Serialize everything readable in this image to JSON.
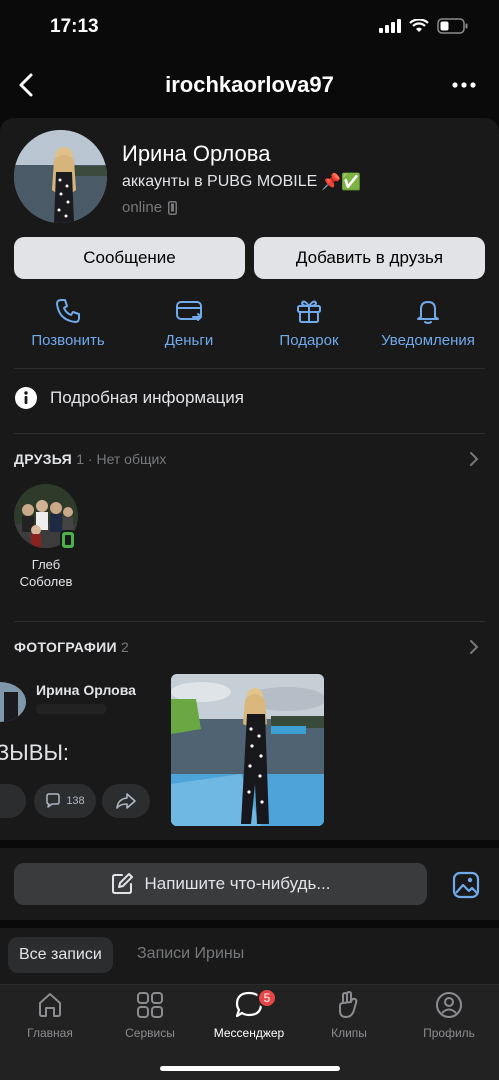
{
  "status_bar": {
    "time": "17:13"
  },
  "header": {
    "title": "irochkaorlova97"
  },
  "profile": {
    "name": "Ирина Орлова",
    "status": "аккаунты в PUBG MOBILE",
    "status_emojis": "📌✅",
    "online": "online"
  },
  "buttons": {
    "message": "Сообщение",
    "add_friend": "Добавить в друзья"
  },
  "actions": [
    {
      "label": "Позвонить",
      "icon": "phone-icon"
    },
    {
      "label": "Деньги",
      "icon": "money-icon"
    },
    {
      "label": "Подарок",
      "icon": "gift-icon"
    },
    {
      "label": "Уведомления",
      "icon": "bell-icon"
    }
  ],
  "details": {
    "label": "Подробная информация"
  },
  "friends": {
    "title": "ДРУЗЬЯ",
    "count": "1",
    "common": "Нет общих",
    "items": [
      {
        "name": "Глеб Соболев"
      }
    ]
  },
  "photos": {
    "title": "ФОТОГРАФИИ",
    "count": "2",
    "post_preview": {
      "author": "Ирина Орлова",
      "text": "ЗЫВЫ:",
      "comments": "138"
    }
  },
  "composer": {
    "placeholder": "Напишите что-нибудь..."
  },
  "wall_tabs": {
    "all": "Все записи",
    "own": "Записи Ирины"
  },
  "tabbar": {
    "items": [
      {
        "label": "Главная",
        "icon": "home-icon"
      },
      {
        "label": "Сервисы",
        "icon": "services-icon"
      },
      {
        "label": "Мессенджер",
        "icon": "messenger-icon",
        "badge": "5"
      },
      {
        "label": "Клипы",
        "icon": "clips-icon"
      },
      {
        "label": "Профиль",
        "icon": "profile-icon"
      }
    ]
  },
  "colors": {
    "accent": "#71aaeb",
    "background": "#19191a",
    "badge": "#e64646"
  }
}
